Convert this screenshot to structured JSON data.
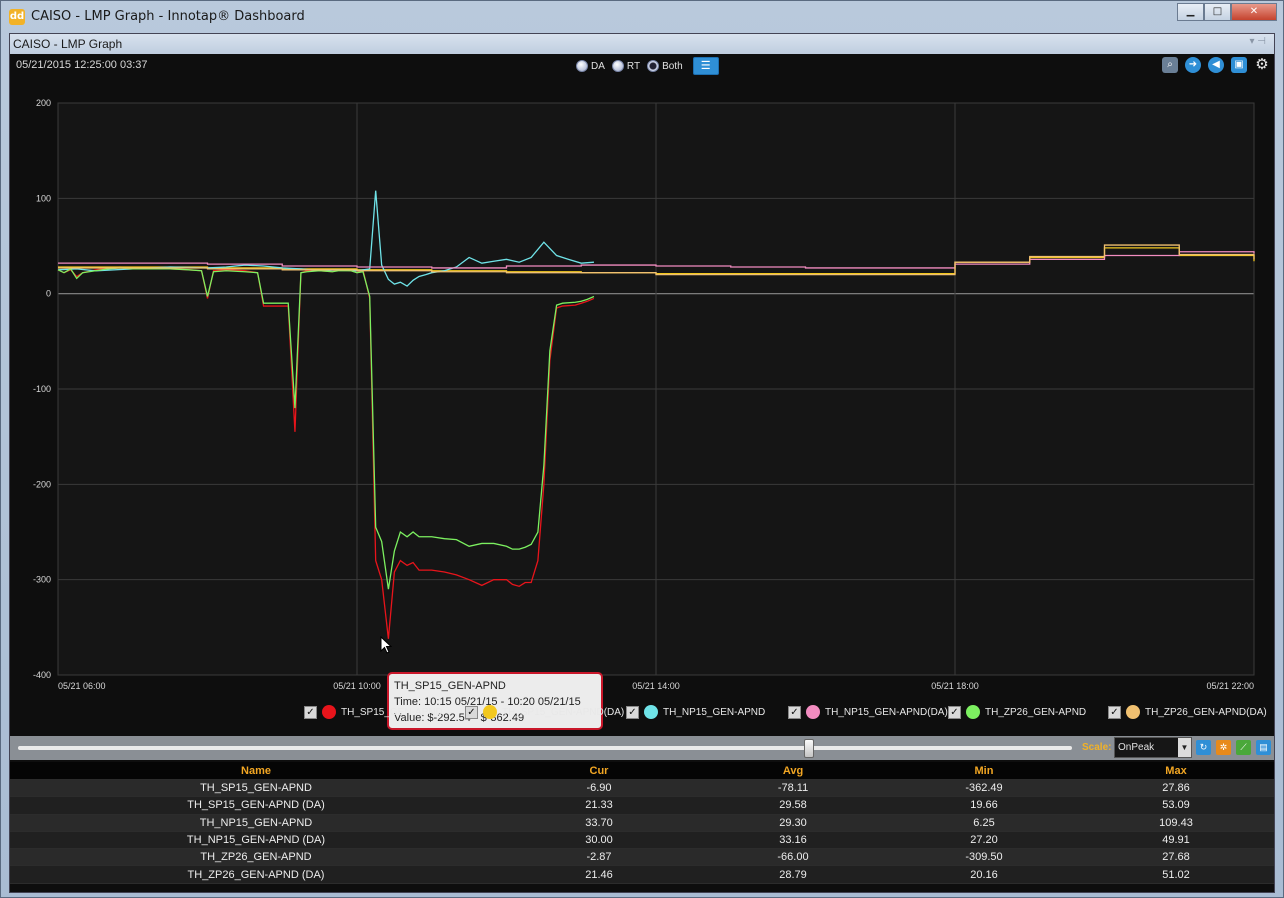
{
  "window": {
    "title": "CAISO - LMP Graph - Innotap® Dashboard",
    "icon_label": "dd",
    "minimize": "▁",
    "maximize": "□",
    "close": "✕"
  },
  "panel": {
    "title": "CAISO - LMP Graph",
    "controls": "▾ ⊣"
  },
  "toolbar": {
    "timestamp": "05/21/2015 12:25:00  03:37",
    "radios": [
      {
        "label": "DA",
        "selected": false
      },
      {
        "label": "RT",
        "selected": false
      },
      {
        "label": "Both",
        "selected": true
      }
    ],
    "list_icon": "list-icon",
    "icons": [
      "search-icon",
      "arrow-right-icon",
      "speaker-icon",
      "save-icon",
      "gear-icon"
    ]
  },
  "chart_data": {
    "type": "line",
    "ylim": [
      -400,
      200
    ],
    "yticks": [
      200,
      100,
      0,
      -100,
      -200,
      -300,
      -400
    ],
    "ytick_labels": [
      "200",
      "100",
      "0",
      "-100",
      "-200",
      "-300",
      "-400"
    ],
    "xlim": [
      6,
      22
    ],
    "xticks": [
      6,
      10,
      14,
      18,
      22
    ],
    "xtick_labels": [
      "05/21 06:00",
      "05/21 10:00",
      "05/21 14:00",
      "05/21 18:00",
      "05/21 22:00"
    ],
    "grid": true,
    "series": [
      {
        "name": "TH_SP15_GEN-APND",
        "color": "#e8141b",
        "step": false,
        "x": [
          6,
          6.08,
          6.17,
          6.25,
          6.33,
          6.5,
          6.67,
          6.83,
          7,
          7.25,
          7.5,
          7.75,
          7.92,
          8,
          8.08,
          8.25,
          8.5,
          8.67,
          8.75,
          8.92,
          9.08,
          9.17,
          9.25,
          9.33,
          9.5,
          9.67,
          9.75,
          9.92,
          10,
          10.08,
          10.17,
          10.25,
          10.33,
          10.42,
          10.5,
          10.58,
          10.67,
          10.75,
          10.83,
          11,
          11.17,
          11.33,
          11.5,
          11.67,
          11.83,
          12,
          12.08,
          12.17,
          12.25,
          12.33,
          12.42,
          12.5,
          12.58,
          12.67,
          12.75,
          12.92,
          13,
          13.08,
          13.17
        ],
        "y": [
          25,
          22,
          25,
          18,
          22,
          25,
          27,
          28,
          27,
          26,
          26,
          25,
          24,
          -5,
          24,
          25,
          24,
          22,
          -13,
          -13,
          -13,
          -145,
          22,
          24,
          24,
          23,
          25,
          24,
          22,
          25,
          -5,
          -280,
          -300,
          -362,
          -292,
          -280,
          -285,
          -282,
          -290,
          -290,
          -292,
          -295,
          -300,
          -306,
          -300,
          -300,
          -305,
          -307,
          -303,
          -303,
          -280,
          -200,
          -70,
          -15,
          -13,
          -12,
          -10,
          -8,
          -5
        ]
      },
      {
        "name": "TH_SP15_GEN-APND(DA)",
        "color": "#f2c81e",
        "step": true,
        "x": [
          6,
          8,
          9,
          10,
          11,
          12,
          13,
          14,
          15,
          16,
          17,
          18,
          19,
          20,
          21,
          22
        ],
        "y": [
          28,
          27,
          26,
          25,
          24,
          23,
          22,
          21,
          21,
          21,
          21,
          33,
          38,
          48,
          40,
          34
        ]
      },
      {
        "name": "TH_NP15_GEN-APND",
        "color": "#6fe3e8",
        "step": false,
        "x": [
          6,
          6.25,
          6.5,
          7,
          7.5,
          8,
          8.25,
          8.5,
          8.75,
          9,
          9.25,
          9.5,
          9.75,
          10,
          10.17,
          10.25,
          10.33,
          10.42,
          10.5,
          10.58,
          10.67,
          10.75,
          10.83,
          10.92,
          11,
          11.17,
          11.33,
          11.5,
          11.67,
          11.83,
          12,
          12.17,
          12.33,
          12.5,
          12.67,
          12.83,
          13,
          13.17
        ],
        "y": [
          25,
          26,
          24,
          26,
          28,
          27,
          28,
          30,
          29,
          27,
          26,
          24,
          25,
          24,
          26,
          108,
          30,
          15,
          10,
          12,
          8,
          14,
          18,
          20,
          22,
          24,
          28,
          38,
          32,
          34,
          36,
          33,
          38,
          54,
          40,
          36,
          32,
          33
        ]
      },
      {
        "name": "TH_NP15_GEN-APND(DA)",
        "color": "#f28cc0",
        "step": true,
        "x": [
          6,
          7,
          8,
          9,
          10,
          11,
          12,
          13,
          14,
          15,
          16,
          17,
          18,
          19,
          20,
          21,
          22
        ],
        "y": [
          32,
          32,
          31,
          29,
          28,
          27,
          29,
          30,
          29,
          28,
          27,
          27,
          31,
          36,
          40,
          44,
          42
        ]
      },
      {
        "name": "TH_ZP26_GEN-APND",
        "color": "#7cf060",
        "step": false,
        "x": [
          6,
          6.08,
          6.17,
          6.25,
          6.33,
          6.5,
          6.67,
          6.83,
          7,
          7.25,
          7.5,
          7.75,
          7.92,
          8,
          8.08,
          8.25,
          8.5,
          8.67,
          8.75,
          8.92,
          9.08,
          9.17,
          9.25,
          9.33,
          9.5,
          9.67,
          9.75,
          9.92,
          10,
          10.08,
          10.17,
          10.25,
          10.33,
          10.42,
          10.5,
          10.58,
          10.67,
          10.75,
          10.83,
          11,
          11.17,
          11.33,
          11.5,
          11.67,
          11.83,
          12,
          12.08,
          12.17,
          12.25,
          12.33,
          12.42,
          12.5,
          12.58,
          12.67,
          12.75,
          12.92,
          13,
          13.08,
          13.17
        ],
        "y": [
          25,
          22,
          26,
          16,
          22,
          24,
          26,
          27,
          26,
          26,
          26,
          25,
          24,
          -3,
          23,
          24,
          23,
          22,
          -10,
          -10,
          -10,
          -120,
          22,
          23,
          24,
          23,
          24,
          24,
          22,
          23,
          -3,
          -245,
          -260,
          -310,
          -270,
          -250,
          -255,
          -250,
          -255,
          -255,
          -257,
          -258,
          -265,
          -262,
          -262,
          -265,
          -268,
          -268,
          -266,
          -263,
          -250,
          -180,
          -60,
          -12,
          -10,
          -9,
          -8,
          -6,
          -3
        ]
      },
      {
        "name": "TH_ZP26_GEN-APND(DA)",
        "color": "#f0c070",
        "step": true,
        "x": [
          6,
          8,
          9,
          10,
          11,
          12,
          13,
          14,
          15,
          16,
          17,
          18,
          19,
          20,
          21,
          22
        ],
        "y": [
          27,
          26,
          25,
          24,
          23,
          22,
          22,
          20,
          20,
          20,
          20,
          33,
          39,
          51,
          41,
          36
        ]
      }
    ]
  },
  "tooltip": {
    "title": "TH_SP15_GEN-APND",
    "time": "Time: 10:15 05/21/15 - 10:20 05/21/15",
    "value": "Value: $-292.54 - $-362.49"
  },
  "legend": [
    {
      "label": "TH_SP15_GEN-APND",
      "color": "#e8141b",
      "checked": "✓"
    },
    {
      "label": "TH_SP15_GEN-APND(DA)",
      "color": "#f2c81e",
      "checked": "✓"
    },
    {
      "label": "TH_NP15_GEN-APND",
      "color": "#6fe3e8",
      "checked": "✓"
    },
    {
      "label": "TH_NP15_GEN-APND(DA)",
      "color": "#f28cc0",
      "checked": "✓"
    },
    {
      "label": "TH_ZP26_GEN-APND",
      "color": "#7cf060",
      "checked": "✓"
    },
    {
      "label": "TH_ZP26_GEN-APND(DA)",
      "color": "#f0c070",
      "checked": "✓"
    }
  ],
  "scale": {
    "label": "Scale:",
    "selected": "OnPeak",
    "slider_fraction": 0.75,
    "icons": [
      "refresh-icon",
      "settings-icon",
      "chart-line-icon",
      "export-icon"
    ]
  },
  "table": {
    "headers": [
      "Name",
      "Cur",
      "Avg",
      "Min",
      "Max"
    ],
    "rows": [
      [
        "TH_SP15_GEN-APND",
        "-6.90",
        "-78.11",
        "-362.49",
        "27.86"
      ],
      [
        "TH_SP15_GEN-APND (DA)",
        "21.33",
        "29.58",
        "19.66",
        "53.09"
      ],
      [
        "TH_NP15_GEN-APND",
        "33.70",
        "29.30",
        "6.25",
        "109.43"
      ],
      [
        "TH_NP15_GEN-APND (DA)",
        "30.00",
        "33.16",
        "27.20",
        "49.91"
      ],
      [
        "TH_ZP26_GEN-APND",
        "-2.87",
        "-66.00",
        "-309.50",
        "27.68"
      ],
      [
        "TH_ZP26_GEN-APND (DA)",
        "21.46",
        "28.79",
        "20.16",
        "51.02"
      ]
    ]
  }
}
